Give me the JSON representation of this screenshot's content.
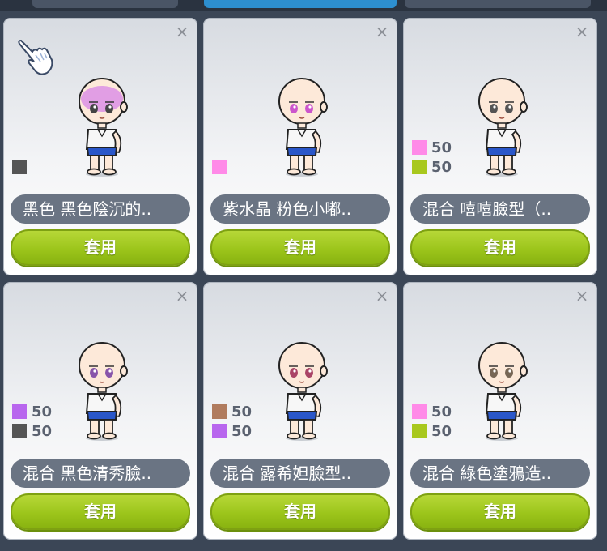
{
  "cards": [
    {
      "name": "黑色 黑色陰沉的..",
      "apply_label": "套用",
      "swatches": [
        {
          "color": "#555555",
          "value": ""
        }
      ],
      "tint": "#d98be6",
      "eye_color": "#444444"
    },
    {
      "name": "紫水晶 粉色小嘟..",
      "apply_label": "套用",
      "swatches": [
        {
          "color": "#ff8ae8",
          "value": ""
        }
      ],
      "tint": "",
      "eye_color": "#cc55cc"
    },
    {
      "name": "混合 嘻嘻臉型（..",
      "apply_label": "套用",
      "swatches": [
        {
          "color": "#ff8ae8",
          "value": "50"
        },
        {
          "color": "#a8c81e",
          "value": "50"
        }
      ],
      "tint": "",
      "eye_color": "#555555"
    },
    {
      "name": "混合 黑色清秀臉..",
      "apply_label": "套用",
      "swatches": [
        {
          "color": "#b866ee",
          "value": "50"
        },
        {
          "color": "#555555",
          "value": "50"
        }
      ],
      "tint": "",
      "eye_color": "#8855aa"
    },
    {
      "name": "混合 露希妲臉型..",
      "apply_label": "套用",
      "swatches": [
        {
          "color": "#b07b5e",
          "value": "50"
        },
        {
          "color": "#b866ee",
          "value": "50"
        }
      ],
      "tint": "",
      "eye_color": "#aa4466"
    },
    {
      "name": "混合 綠色塗鴉造..",
      "apply_label": "套用",
      "swatches": [
        {
          "color": "#ff8ae8",
          "value": "50"
        },
        {
          "color": "#a8c81e",
          "value": "50"
        }
      ],
      "tint": "",
      "eye_color": "#776655"
    }
  ]
}
